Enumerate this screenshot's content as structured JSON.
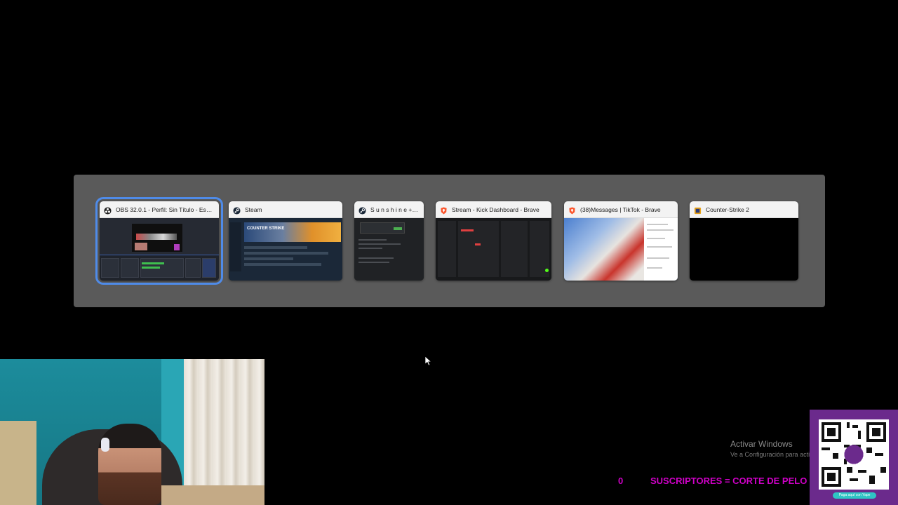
{
  "switcher": {
    "windows": [
      {
        "title": "OBS 32.0.1 - Perfil: Sin Título - Escen...",
        "icon": "obs-icon",
        "selected": true
      },
      {
        "title": "Steam",
        "icon": "steam-icon",
        "selected": false
      },
      {
        "title": "S u n s h i n e + 1...",
        "icon": "sunshine-icon",
        "selected": false
      },
      {
        "title": "Stream - Kick Dashboard - Brave",
        "icon": "brave-icon",
        "selected": false
      },
      {
        "title": "(38)Messages | TikTok - Brave",
        "icon": "brave-icon",
        "selected": false
      },
      {
        "title": "Counter-Strike 2",
        "icon": "cs2-icon",
        "selected": false
      }
    ]
  },
  "steam_thumb_logo": "COUNTER STRIKE",
  "activation": {
    "line1": "Activar Windows",
    "line2": "Ve a Configuración para activar Windows."
  },
  "overlay": {
    "subs_count": "0",
    "subs_text": "SUSCRIPTORES = CORTE DE PELO",
    "qr_caption": "Paga aquí con Yape"
  },
  "colors": {
    "accent_selection": "#4f8be8",
    "overlay_magenta": "#d000c8",
    "qr_panel": "#6b2a8c"
  }
}
